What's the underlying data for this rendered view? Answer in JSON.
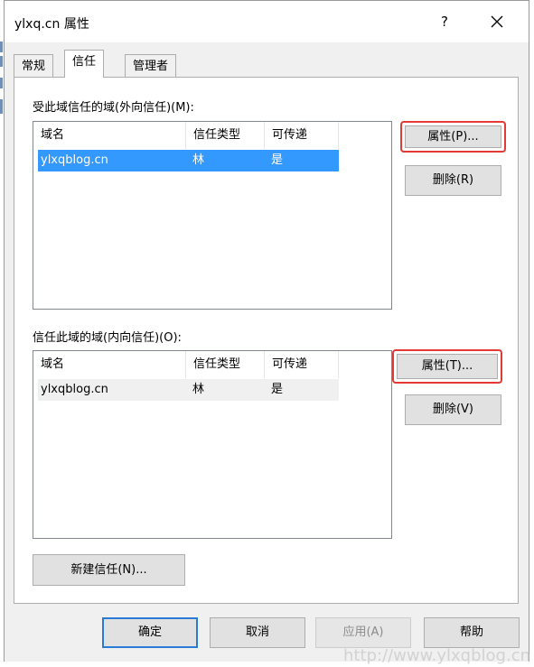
{
  "window": {
    "title": "ylxq.cn 属性",
    "help_label": "?"
  },
  "tabs": [
    {
      "label": "常规",
      "active": false
    },
    {
      "label": "信任",
      "active": true
    },
    {
      "label": "管理者",
      "active": false
    }
  ],
  "outgoing": {
    "label": "受此域信任的域(外向信任)(M):",
    "columns": [
      "域名",
      "信任类型",
      "可传递"
    ],
    "rows": [
      {
        "domain": "ylxqblog.cn",
        "trust_type": "林",
        "transitive": "是"
      }
    ],
    "properties_label": "属性(P)...",
    "remove_label": "删除(R)"
  },
  "incoming": {
    "label": "信任此域的域(内向信任)(O):",
    "columns": [
      "域名",
      "信任类型",
      "可传递"
    ],
    "rows": [
      {
        "domain": "ylxqblog.cn",
        "trust_type": "林",
        "transitive": "是"
      }
    ],
    "properties_label": "属性(T)...",
    "remove_label": "删除(V)"
  },
  "new_trust_label": "新建信任(N)...",
  "footer": {
    "ok_label": "确定",
    "cancel_label": "取消",
    "apply_label": "应用(A)",
    "help_label": "帮助"
  },
  "watermark": "http://www.ylxqblog.cn",
  "colors": {
    "selection": "#3399ff",
    "highlight_box": "#e53935",
    "default_button_border": "#2a7ad6"
  }
}
